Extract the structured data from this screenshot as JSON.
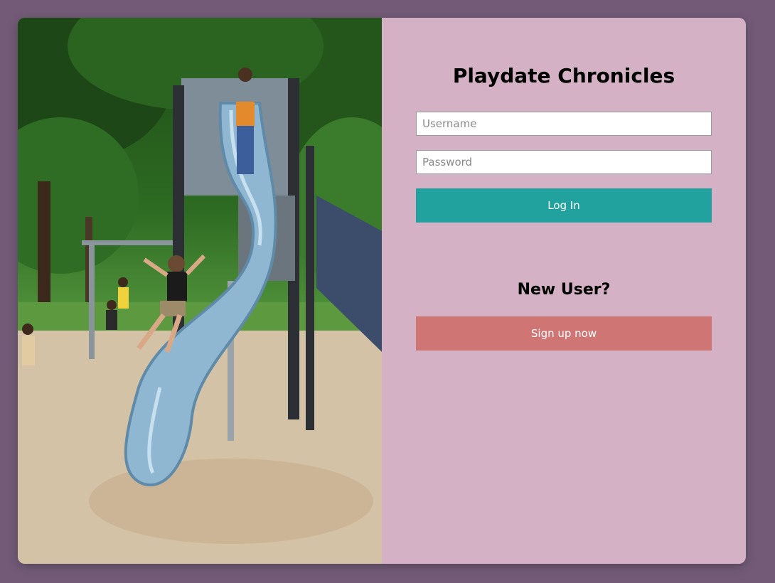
{
  "login": {
    "title": "Playdate Chronicles",
    "username_placeholder": "Username",
    "password_placeholder": "Password",
    "login_label": "Log In"
  },
  "signup": {
    "heading": "New User?",
    "button_label": "Sign up now"
  },
  "colors": {
    "page_background": "#735b78",
    "panel_background": "#d4b1c5",
    "login_button": "#22a29f",
    "signup_button": "#cf7675"
  },
  "image": {
    "subject": "child sliding down a blue playground slide"
  }
}
